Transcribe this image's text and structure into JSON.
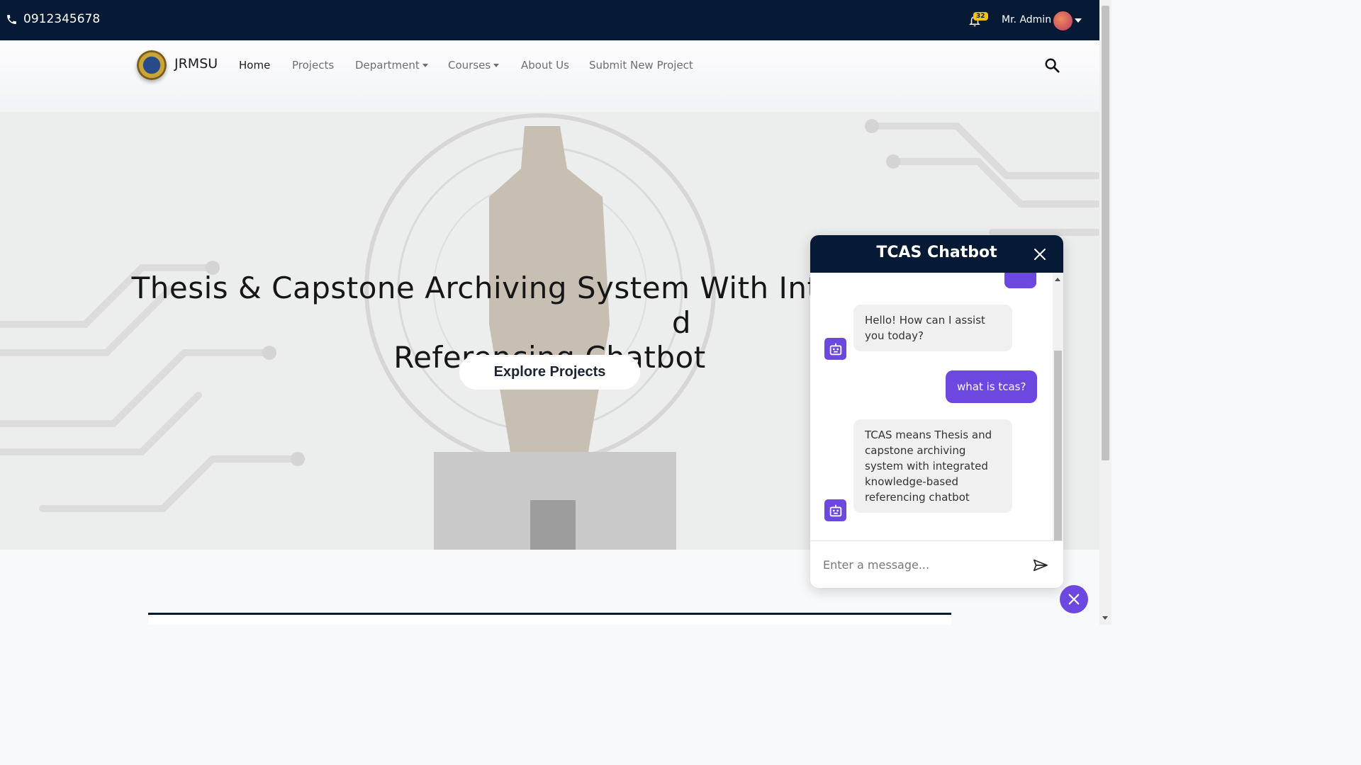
{
  "topbar": {
    "phone": "0912345678",
    "notification_count": "32",
    "user_name": "Mr. Admin"
  },
  "navbar": {
    "brand": "JRMSU",
    "items": [
      {
        "label": "Home",
        "active": true,
        "dropdown": false
      },
      {
        "label": "Projects",
        "active": false,
        "dropdown": false
      },
      {
        "label": "Department",
        "active": false,
        "dropdown": true
      },
      {
        "label": "Courses",
        "active": false,
        "dropdown": true
      },
      {
        "label": "About Us",
        "active": false,
        "dropdown": false
      },
      {
        "label": "Submit New Project",
        "active": false,
        "dropdown": false
      }
    ]
  },
  "hero": {
    "title_line1": "Thesis & Capstone Archiving System With Integrated K",
    "title_line1_end": "d",
    "title_line2": "Referencing Chatbot",
    "cta": "Explore Projects"
  },
  "chatbot": {
    "title": "TCAS Chatbot",
    "messages": [
      {
        "from": "bot",
        "text": "Hello! How can I assist you today?"
      },
      {
        "from": "user",
        "text": "what is tcas?"
      },
      {
        "from": "bot",
        "text": "TCAS means Thesis and capstone archiving system with integrated knowledge-based referencing chatbot"
      }
    ],
    "input_placeholder": "Enter a message..."
  },
  "colors": {
    "dark_navy": "#061a36",
    "accent_purple": "#6c48e0",
    "bubble_gray": "#f0f0f0"
  },
  "icons": [
    "phone-icon",
    "bell-icon",
    "avatar",
    "search-icon",
    "close-icon",
    "bot-icon",
    "send-icon"
  ]
}
